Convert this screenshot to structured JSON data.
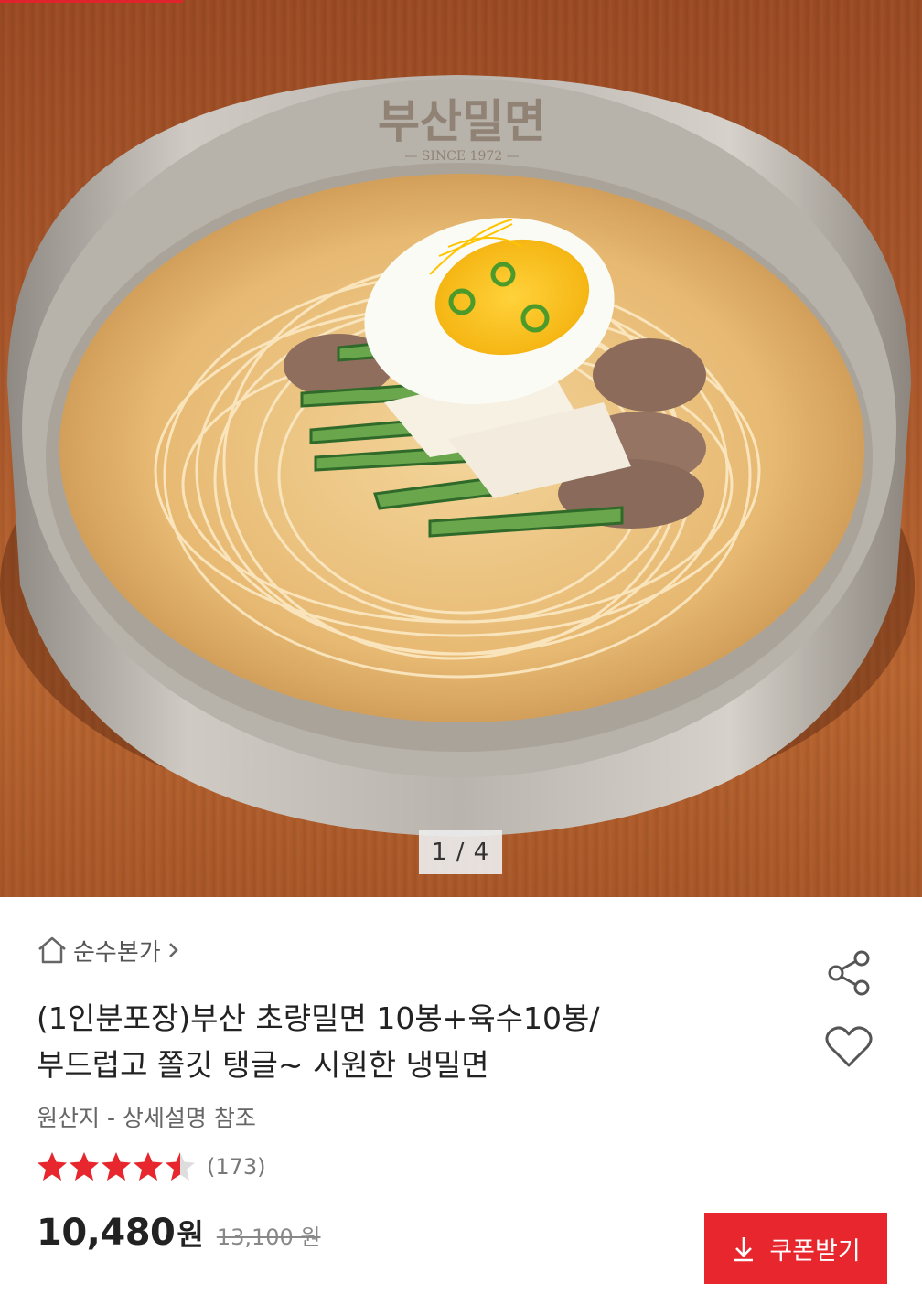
{
  "hero": {
    "bowl_logo": "부산밀면",
    "bowl_logo_sub": "— SINCE 1972 —",
    "page_indicator": "1 / 4"
  },
  "seller": {
    "icon": "home-icon",
    "name": "순수본가",
    "chevron": "chevron-right-icon"
  },
  "product": {
    "title_line1": "(1인분포장)부산 초량밀면 10봉+육수10봉/",
    "title_line2": "부드럽고 쫄깃 탱글~ 시원한 냉밀면",
    "origin": "원산지 - 상세설명 참조",
    "rating": 4.5,
    "rating_max": 5,
    "review_count": "(173)",
    "price": "10,480",
    "price_unit": "원",
    "original_price": "13,100 원"
  },
  "actions": {
    "share_icon": "share-icon",
    "wish_icon": "heart-icon",
    "coupon_label": "쿠폰받기",
    "coupon_icon": "download-icon"
  },
  "colors": {
    "accent": "#e8262d",
    "star": "#e8262d",
    "text": "#222222",
    "muted": "#666666"
  }
}
